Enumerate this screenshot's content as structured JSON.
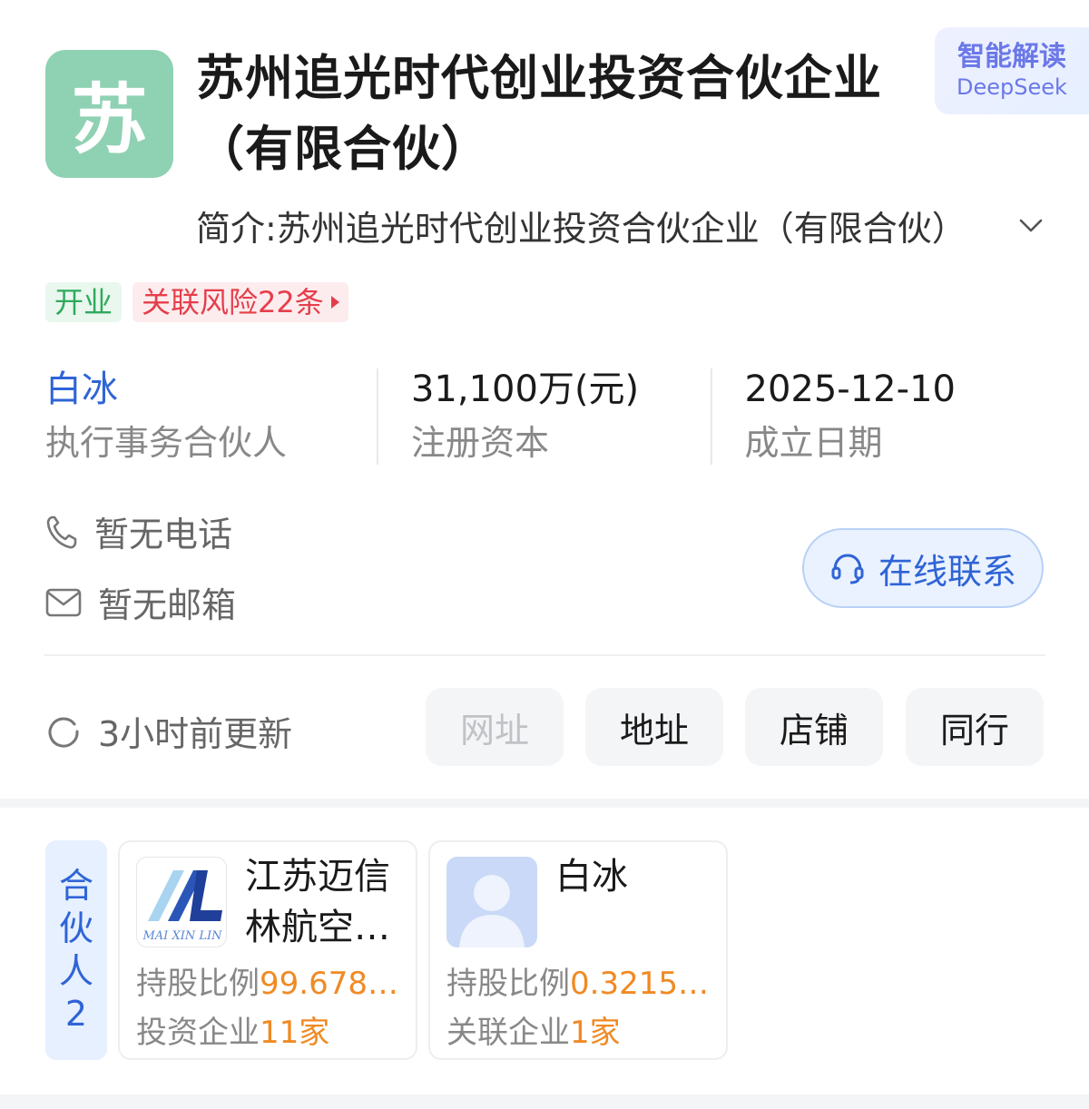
{
  "company": {
    "logo_char": "苏",
    "name": "苏州追光时代创业投资合伙企业（有限合伙）",
    "intro": "简介:苏州追光时代创业投资合伙企业（有限合伙）",
    "ai_badge": {
      "line1": "智能解读",
      "line2": "DeepSeek"
    },
    "tags": [
      {
        "label": "开业",
        "color": "#2faa5c"
      },
      {
        "label": "关联风险22条",
        "color": "#e53e4b"
      }
    ]
  },
  "stats": [
    {
      "value": "白冰",
      "label": "执行事务合伙人"
    },
    {
      "value": "31,100万(元)",
      "label": "注册资本"
    },
    {
      "value": "2025-12-10",
      "label": "成立日期"
    }
  ],
  "contact": {
    "phone": "暂无电话",
    "email": "暂无邮箱",
    "online_button": "在线联系"
  },
  "update": {
    "text": "3小时前更新"
  },
  "actions": [
    {
      "label": "网址",
      "enabled": false
    },
    {
      "label": "地址",
      "enabled": true
    },
    {
      "label": "店铺",
      "enabled": true
    },
    {
      "label": "同行",
      "enabled": true
    }
  ],
  "partners": {
    "label_chars": [
      "合",
      "伙",
      "人",
      "2"
    ],
    "items": [
      {
        "name": "江苏迈信林航空科技股份有限公司",
        "logo_text": "MAI XIN LIN",
        "ratio_label": "持股比例",
        "ratio_value": "99.678…",
        "extra_label": "投资企业",
        "extra_value": "11家"
      },
      {
        "name": "白冰",
        "ratio_label": "持股比例",
        "ratio_value": "0.3215…",
        "extra_label": "关联企业",
        "extra_value": "1家"
      }
    ]
  },
  "colors": {
    "accent_blue": "#2f64d6",
    "highlight_orange": "#f08a24",
    "logo_green": "#8fd1b3"
  }
}
